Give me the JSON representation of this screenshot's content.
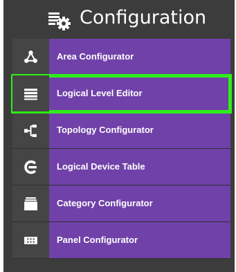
{
  "header": {
    "title": "Configuration",
    "icon": "configuration-gear-icon"
  },
  "menu": {
    "items": [
      {
        "label": "Area Configurator",
        "icon": "area-network-icon"
      },
      {
        "label": "Logical Level Editor",
        "icon": "layers-icon",
        "highlighted": true
      },
      {
        "label": "Topology Configurator",
        "icon": "topology-icon"
      },
      {
        "label": "Logical Device Table",
        "icon": "logical-device-icon"
      },
      {
        "label": "Category Configurator",
        "icon": "category-drawer-icon"
      },
      {
        "label": "Panel Configurator",
        "icon": "panel-keypad-icon"
      }
    ]
  },
  "colors": {
    "panel_bg": "#3c3c3c",
    "item_bg": "#7041a8",
    "icon_bg": "#454545",
    "highlight": "#2ef01a"
  }
}
